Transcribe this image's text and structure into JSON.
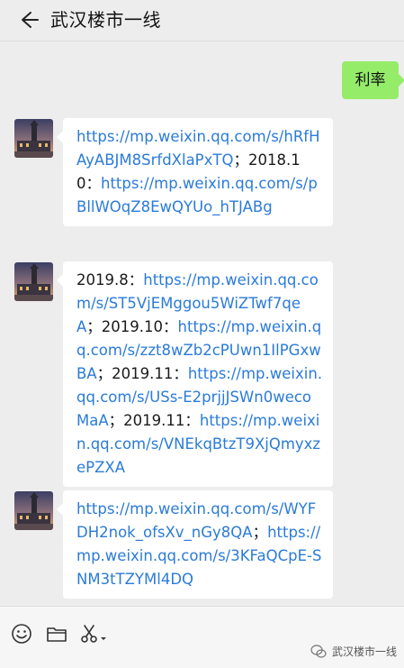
{
  "header": {
    "title": "武汉楼市一线"
  },
  "messages": {
    "sent": {
      "text": "利率"
    },
    "m1": {
      "link1": "https://mp.weixin.qq.com/s/hRfHAyABJM8SrfdXlaPxTQ",
      "sep1": "；",
      "label2": "2018.10：",
      "link2": "https://mp.weixin.qq.com/s/pBllWOqZ8EwQYUo_hTJABg"
    },
    "m2": {
      "label1": "2019.8：",
      "link1": "https://mp.weixin.qq.com/s/ST5VjEMggou5WiZTwf7qeA",
      "label2": "；2019.10：",
      "link2": "https://mp.weixin.qq.com/s/zzt8wZb2cPUwn1IlPGxwBA",
      "label3": "；2019.11：",
      "link3": "https://mp.weixin.qq.com/s/USs-E2prjjJSWn0wecoMaA",
      "label4": "；2019.11：",
      "link4": "https://mp.weixin.qq.com/s/VNEkqBtzT9XjQmyxzePZXA"
    },
    "m3": {
      "link1": "https://mp.weixin.qq.com/s/WYFDH2nok_ofsXv_nGy8QA",
      "sep1": "；",
      "link2": "https://mp.weixin.qq.com/s/3KFaQCpE-SNM3tTZYMl4DQ"
    }
  },
  "toolbar": {
    "icons": [
      "emoji-icon",
      "folder-icon",
      "scissors-icon",
      "dropdown-arrow-icon"
    ]
  },
  "watermark": {
    "text": "武汉楼市一线"
  },
  "colors": {
    "link": "#2b7bd8",
    "sent_bubble": "#95ec69",
    "background": "#ededed"
  }
}
